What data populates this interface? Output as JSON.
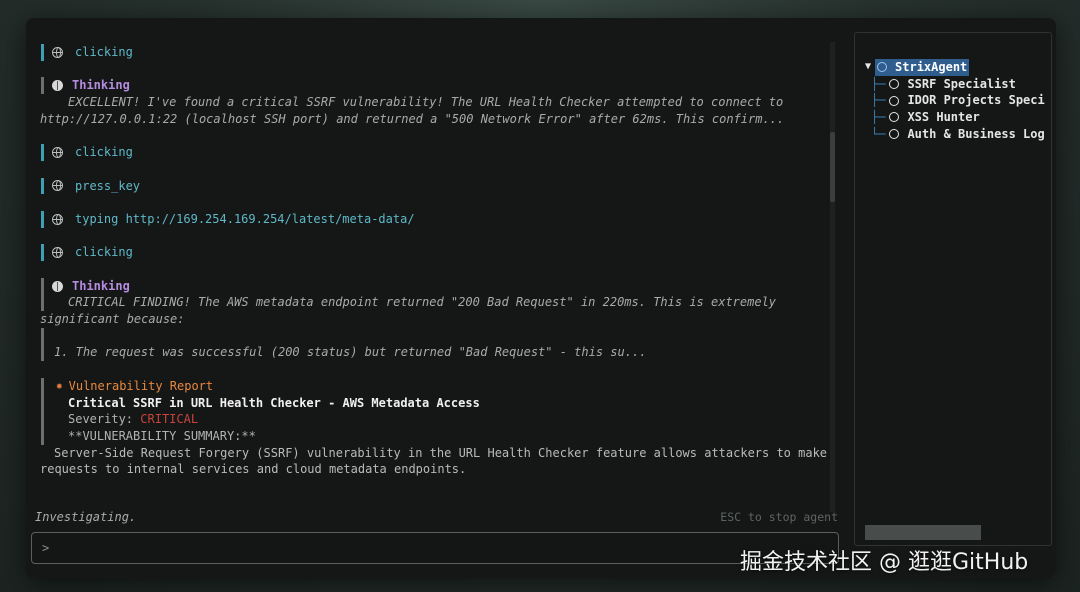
{
  "log": {
    "entries": [
      {
        "type": "action",
        "icon": "globe-icon",
        "text": "clicking"
      },
      {
        "type": "thinking",
        "label": "Thinking",
        "lines": [
          "EXCELLENT! I've found a critical SSRF vulnerability! The URL Health Checker attempted to connect to",
          "http://127.0.0.1:22 (localhost SSH port) and returned a \"500 Network Error\" after 62ms. This confirm..."
        ]
      },
      {
        "type": "action",
        "icon": "globe-icon",
        "text": "clicking"
      },
      {
        "type": "action",
        "icon": "globe-icon",
        "text": "press_key"
      },
      {
        "type": "action",
        "icon": "globe-icon",
        "text": "typing http://169.254.169.254/latest/meta-data/"
      },
      {
        "type": "action",
        "icon": "globe-icon",
        "text": "clicking"
      },
      {
        "type": "thinking",
        "label": "Thinking",
        "lines": [
          "CRITICAL FINDING! The AWS metadata endpoint returned \"200 Bad Request\" in 220ms. This is extremely",
          "significant because:",
          "",
          "1. The request was successful (200 status) but returned \"Bad Request\" - this su..."
        ]
      }
    ],
    "report": {
      "label": "Vulnerability Report",
      "title": "Critical SSRF in URL Health Checker - AWS Metadata Access",
      "severity_label": "Severity:",
      "severity_value": "CRITICAL",
      "summary_heading": "**VULNERABILITY SUMMARY:**",
      "body_lines": [
        "Server-Side Request Forgery (SSRF) vulnerability in the URL Health Checker feature allows attackers to make",
        "requests to internal services and cloud metadata endpoints."
      ]
    }
  },
  "status": {
    "text": "Investigating.",
    "hint": "ESC to stop agent"
  },
  "input": {
    "placeholder": ">"
  },
  "tree": {
    "root": "StrixAgent",
    "children": [
      "SSRF Specialist",
      "IDOR Projects Speci",
      "XSS Hunter",
      "Auth & Business Log"
    ]
  },
  "watermark": "掘金技术社区 @ 逛逛GitHub",
  "colors": {
    "accent_teal": "#3f9fb4",
    "thinking_purple": "#b58ce0",
    "vuln_orange": "#e8883e",
    "critical_red": "#c7433b",
    "selected_blue": "#2f5d8e"
  }
}
